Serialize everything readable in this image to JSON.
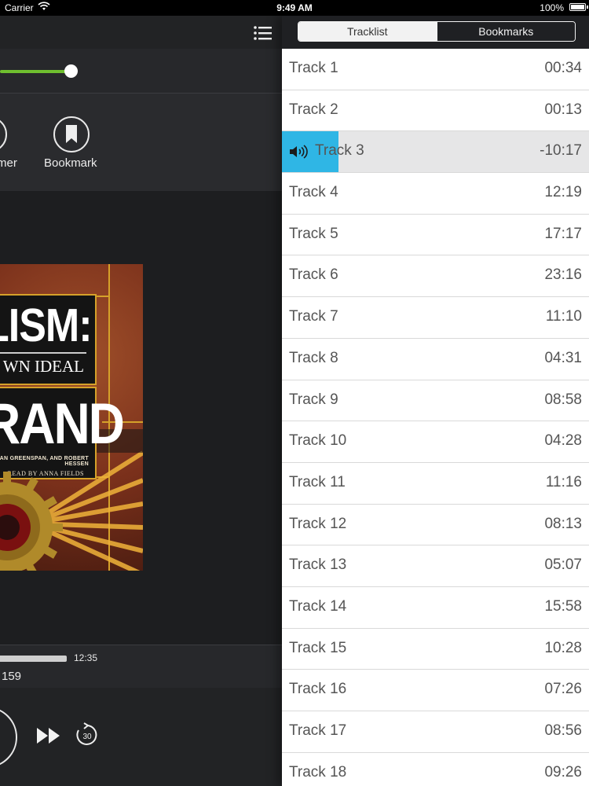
{
  "status_bar": {
    "carrier": "Carrier",
    "time": "9:49 AM",
    "battery": "100%"
  },
  "player": {
    "seek_progress": 0.25,
    "actions": {
      "timer_label": "mer",
      "bookmark_label": "Bookmark"
    },
    "cover": {
      "title_line1": "LISM:",
      "subtitle": "WN IDEAL",
      "title_line2": "RAND",
      "contributors": ", ALAN GREENSPAN, AND ROBERT HESSEN",
      "reader": "READ BY ANNA FIELDS"
    },
    "scrub": {
      "duration": "12:35",
      "left_text": "159"
    },
    "controls": {
      "skip_label": "30"
    }
  },
  "tracklist": {
    "tabs": [
      "Tracklist",
      "Bookmarks"
    ],
    "active_tab": 0,
    "tracks": [
      {
        "name": "Track 1",
        "time": "00:34"
      },
      {
        "name": "Track 2",
        "time": "00:13"
      },
      {
        "name": "Track 3",
        "time": "-10:17",
        "playing": true
      },
      {
        "name": "Track 4",
        "time": "12:19"
      },
      {
        "name": "Track 5",
        "time": "17:17"
      },
      {
        "name": "Track 6",
        "time": "23:16"
      },
      {
        "name": "Track 7",
        "time": "11:10"
      },
      {
        "name": "Track 8",
        "time": "04:31"
      },
      {
        "name": "Track 9",
        "time": "08:58"
      },
      {
        "name": "Track 10",
        "time": "04:28"
      },
      {
        "name": "Track 11",
        "time": "11:16"
      },
      {
        "name": "Track 12",
        "time": "08:13"
      },
      {
        "name": "Track 13",
        "time": "05:07"
      },
      {
        "name": "Track 14",
        "time": "15:58"
      },
      {
        "name": "Track 15",
        "time": "10:28"
      },
      {
        "name": "Track 16",
        "time": "07:26"
      },
      {
        "name": "Track 17",
        "time": "08:56"
      },
      {
        "name": "Track 18",
        "time": "09:26"
      }
    ]
  },
  "colors": {
    "accent_green": "#6fbf2f",
    "accent_blue": "#2fb6e5"
  }
}
